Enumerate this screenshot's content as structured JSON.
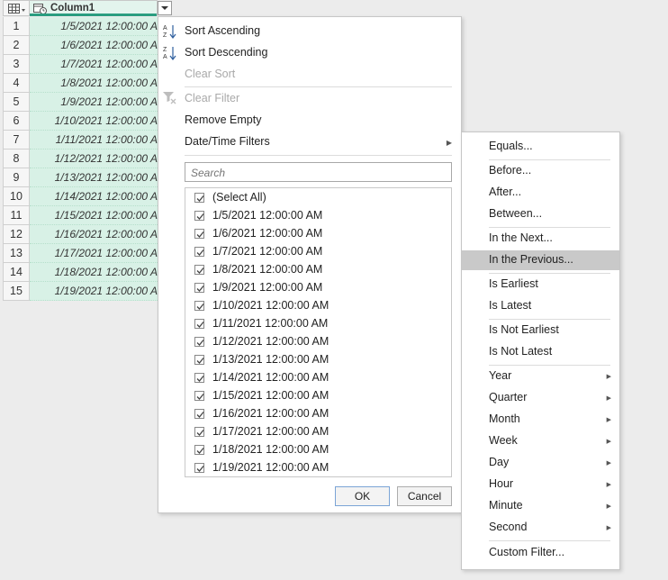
{
  "grid": {
    "column_name": "Column1",
    "row_numbers": [
      "1",
      "2",
      "3",
      "4",
      "5",
      "6",
      "7",
      "8",
      "9",
      "10",
      "11",
      "12",
      "13",
      "14",
      "15"
    ],
    "cells": [
      "1/5/2021 12:00:00 A",
      "1/6/2021 12:00:00 A",
      "1/7/2021 12:00:00 A",
      "1/8/2021 12:00:00 A",
      "1/9/2021 12:00:00 A",
      "1/10/2021 12:00:00 A",
      "1/11/2021 12:00:00 A",
      "1/12/2021 12:00:00 A",
      "1/13/2021 12:00:00 A",
      "1/14/2021 12:00:00 A",
      "1/15/2021 12:00:00 A",
      "1/16/2021 12:00:00 A",
      "1/17/2021 12:00:00 A",
      "1/18/2021 12:00:00 A",
      "1/19/2021 12:00:00 A"
    ]
  },
  "filter_menu": {
    "sort_ascending": "Sort Ascending",
    "sort_descending": "Sort Descending",
    "clear_sort": "Clear Sort",
    "clear_filter": "Clear Filter",
    "remove_empty": "Remove Empty",
    "datetime_filters": "Date/Time Filters",
    "search_placeholder": "Search",
    "select_all": "(Select All)",
    "values": [
      "1/5/2021 12:00:00 AM",
      "1/6/2021 12:00:00 AM",
      "1/7/2021 12:00:00 AM",
      "1/8/2021 12:00:00 AM",
      "1/9/2021 12:00:00 AM",
      "1/10/2021 12:00:00 AM",
      "1/11/2021 12:00:00 AM",
      "1/12/2021 12:00:00 AM",
      "1/13/2021 12:00:00 AM",
      "1/14/2021 12:00:00 AM",
      "1/15/2021 12:00:00 AM",
      "1/16/2021 12:00:00 AM",
      "1/17/2021 12:00:00 AM",
      "1/18/2021 12:00:00 AM",
      "1/19/2021 12:00:00 AM"
    ],
    "ok": "OK",
    "cancel": "Cancel"
  },
  "submenu": {
    "equals": "Equals...",
    "before": "Before...",
    "after": "After...",
    "between": "Between...",
    "in_the_next": "In the Next...",
    "in_the_previous": "In the Previous...",
    "is_earliest": "Is Earliest",
    "is_latest": "Is Latest",
    "is_not_earliest": "Is Not Earliest",
    "is_not_latest": "Is Not Latest",
    "year": "Year",
    "quarter": "Quarter",
    "month": "Month",
    "week": "Week",
    "day": "Day",
    "hour": "Hour",
    "minute": "Minute",
    "second": "Second",
    "custom_filter": "Custom Filter...",
    "highlighted": "in_the_previous"
  },
  "colors": {
    "accent": "#2a9d80",
    "cell_bg": "#d8f1e6",
    "highlight": "#c9c9c9"
  }
}
